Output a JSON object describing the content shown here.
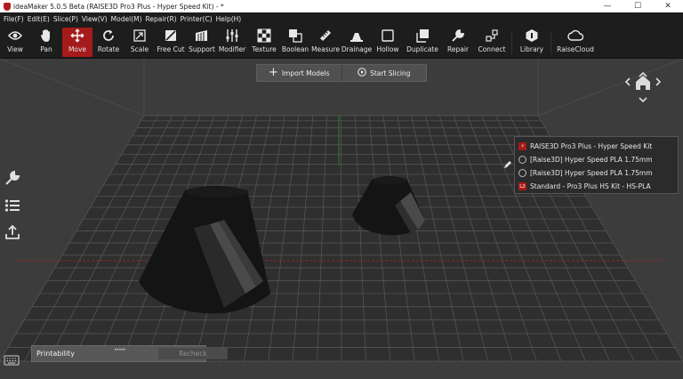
{
  "window": {
    "title": "ideaMaker 5.0.5 Beta (RAISE3D Pro3 Plus - Hyper Speed Kit) - *",
    "controls": [
      "—",
      "☐",
      "✕"
    ]
  },
  "menu": [
    "File(F)",
    "Edit(E)",
    "Slice(P)",
    "View(V)",
    "Model(M)",
    "Repair(R)",
    "Printer(C)",
    "Help(H)"
  ],
  "toolbar": {
    "active": "Move",
    "tools": [
      "View",
      "Pan",
      "Move",
      "Rotate",
      "Scale",
      "Free Cut",
      "Support",
      "Modifier",
      "Texture",
      "Boolean",
      "Measure",
      "Drainage",
      "Hollow",
      "Duplicate",
      "Repair",
      "Connect",
      "Library",
      "RaiseCloud"
    ]
  },
  "actions": {
    "import_label": "Import Models",
    "slice_label": "Start Slicing"
  },
  "profile": {
    "printer": "RAISE3D Pro3 Plus - Hyper Speed Kit",
    "filament_left": "[Raise3D] Hyper Speed PLA 1.75mm",
    "filament_right": "[Raise3D] Hyper Speed PLA 1.75mm",
    "template": "Standard - Pro3 Plus HS Kit - HS-PLA",
    "template_badge": "L2"
  },
  "printability": {
    "title": "Printability",
    "recheck_label": "Recheck"
  },
  "colors": {
    "accent": "#a51b1b",
    "toolbar_bg": "#1d1d1d",
    "viewport_bg": "#3c3c3c"
  }
}
